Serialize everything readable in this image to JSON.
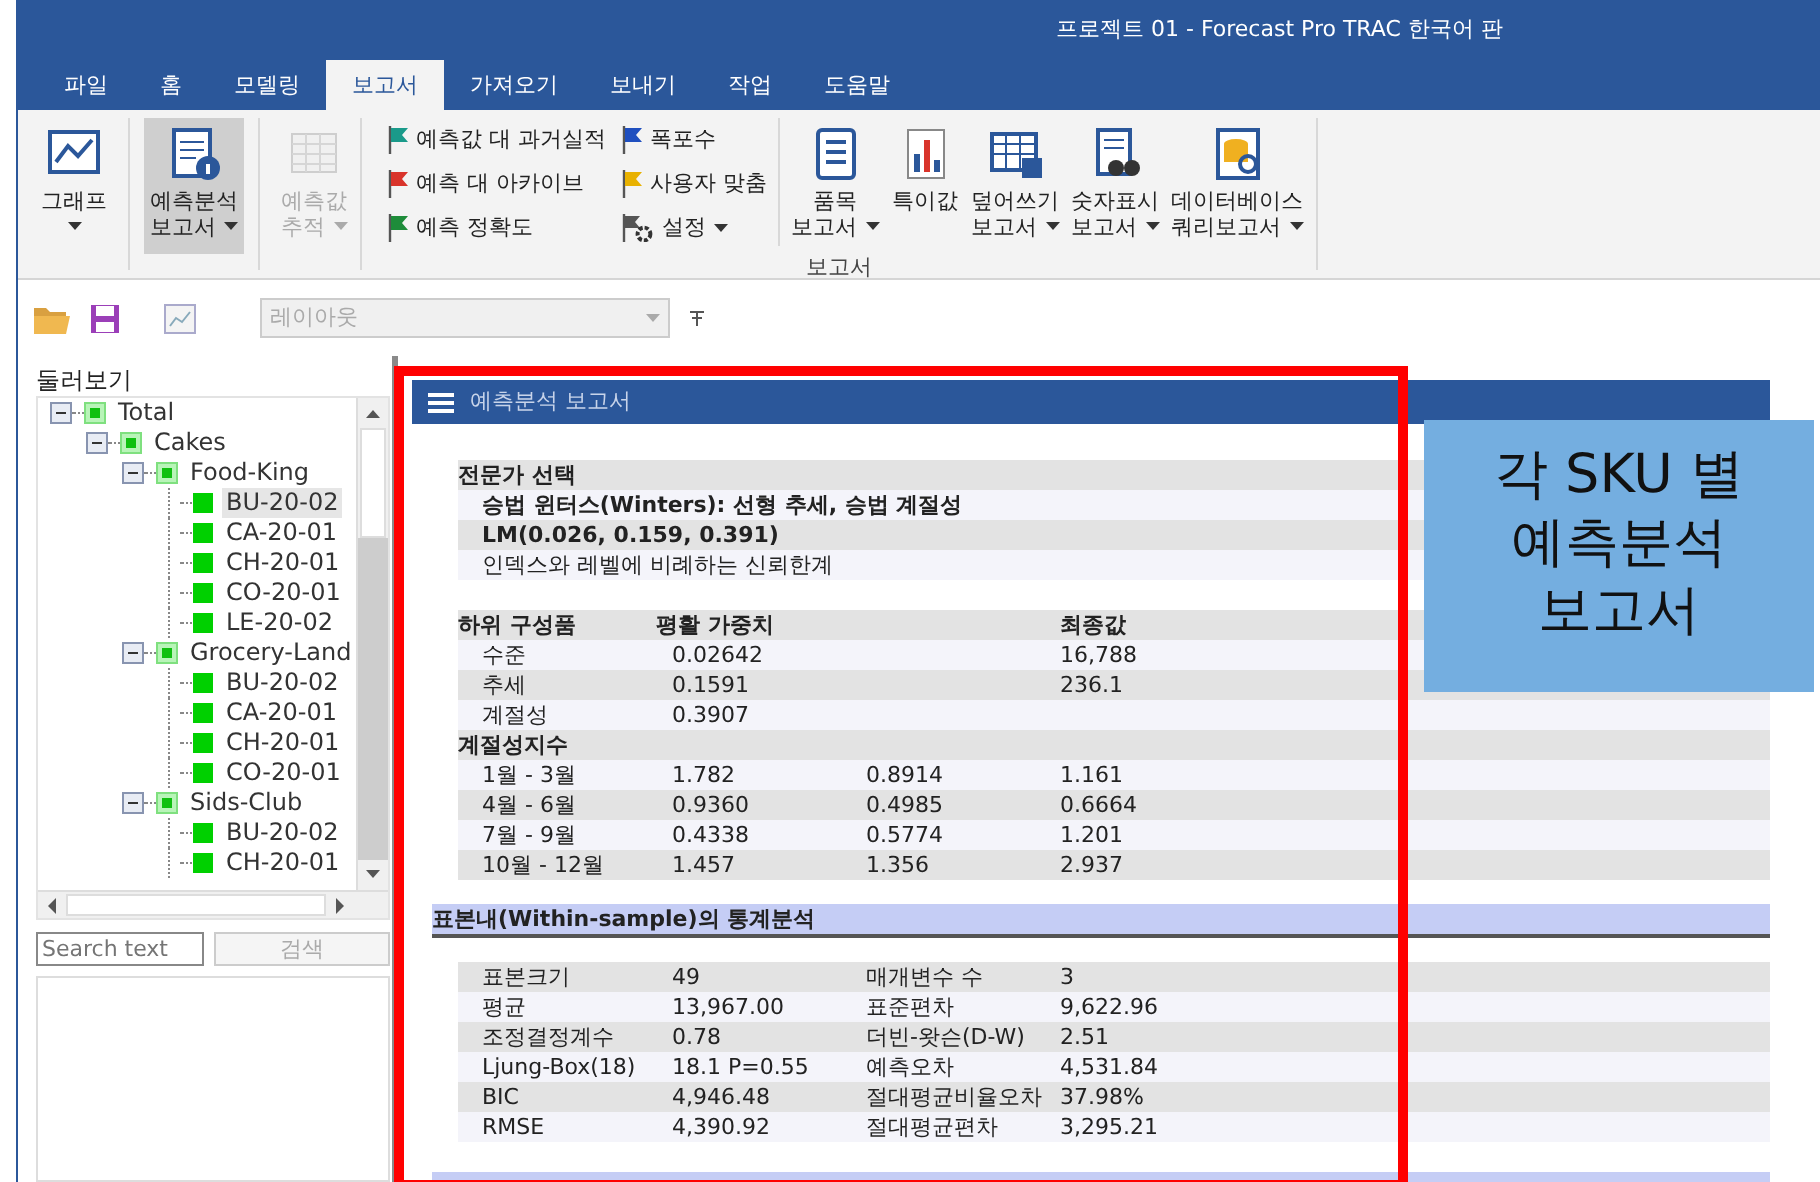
{
  "window": {
    "title": "프로젝트 01 - Forecast Pro TRAC 한국어 판"
  },
  "tabs": [
    {
      "label": "파일",
      "selected": false
    },
    {
      "label": "홈",
      "selected": false
    },
    {
      "label": "모델링",
      "selected": false
    },
    {
      "label": "보고서",
      "selected": true
    },
    {
      "label": "가져오기",
      "selected": false
    },
    {
      "label": "보내기",
      "selected": false
    },
    {
      "label": "작업",
      "selected": false
    },
    {
      "label": "도움말",
      "selected": false
    }
  ],
  "ribbon": {
    "left_buttons": [
      {
        "lines": [
          "그래프"
        ],
        "dropdown": true,
        "selected": false,
        "disabled": false
      },
      {
        "lines": [
          "예측분석",
          "보고서"
        ],
        "dropdown": true,
        "selected": true,
        "disabled": false
      },
      {
        "lines": [
          "예측값",
          "추적"
        ],
        "dropdown": true,
        "selected": false,
        "disabled": true
      }
    ],
    "small_buttons": [
      {
        "kind": "flag",
        "label": "예측값 대 과거실적",
        "color": "#1a9a8a",
        "dropdown": false
      },
      {
        "kind": "flag",
        "label": "예측 대 아카이브",
        "color": "#d9342b",
        "dropdown": false
      },
      {
        "kind": "flag",
        "label": "예측 정확도",
        "color": "#1e8c3a",
        "dropdown": false
      },
      {
        "kind": "flag",
        "label": "폭포수",
        "color": "#1f4fbf",
        "dropdown": false
      },
      {
        "kind": "flag",
        "label": "사용자 맞춤",
        "color": "#e8b100",
        "dropdown": false
      },
      {
        "kind": "settings",
        "label": "설정",
        "color": "#555555",
        "dropdown": true
      }
    ],
    "right_buttons": [
      {
        "lines": [
          "품목",
          "보고서"
        ],
        "dropdown": true
      },
      {
        "lines": [
          "특이값"
        ],
        "dropdown": false
      },
      {
        "lines": [
          "덮어쓰기",
          "보고서"
        ],
        "dropdown": true
      },
      {
        "lines": [
          "숫자표시",
          "보고서"
        ],
        "dropdown": true
      },
      {
        "lines": [
          "데이터베이스",
          "쿼리보고서"
        ],
        "dropdown": true
      }
    ],
    "group_label": "보고서"
  },
  "toolbar": {
    "layout_select": {
      "placeholder": "레이아웃",
      "disabled": true
    }
  },
  "navigator": {
    "title": "둘러보기",
    "tree": [
      {
        "label": "Total",
        "expanded": true,
        "selected": false,
        "children": [
          {
            "label": "Cakes",
            "expanded": true,
            "selected": false,
            "children": [
              {
                "label": "Food-King",
                "expanded": true,
                "selected": false,
                "children": [
                  {
                    "label": "BU-20-02",
                    "selected": true
                  },
                  {
                    "label": "CA-20-01",
                    "selected": false
                  },
                  {
                    "label": "CH-20-01",
                    "selected": false
                  },
                  {
                    "label": "CO-20-01",
                    "selected": false
                  },
                  {
                    "label": "LE-20-02",
                    "selected": false
                  }
                ]
              },
              {
                "label": "Grocery-Land",
                "expanded": true,
                "selected": false,
                "children": [
                  {
                    "label": "BU-20-02",
                    "selected": false
                  },
                  {
                    "label": "CA-20-01",
                    "selected": false
                  },
                  {
                    "label": "CH-20-01",
                    "selected": false
                  },
                  {
                    "label": "CO-20-01",
                    "selected": false
                  }
                ]
              },
              {
                "label": "Sids-Club",
                "expanded": true,
                "selected": false,
                "children": [
                  {
                    "label": "BU-20-02",
                    "selected": false
                  },
                  {
                    "label": "CH-20-01",
                    "selected": false
                  }
                ]
              }
            ]
          }
        ]
      }
    ],
    "search": {
      "placeholder": "Search text"
    },
    "search_button": {
      "label": "검색",
      "disabled": true
    }
  },
  "report": {
    "title": "예측분석 보고서",
    "blocks": [
      {
        "kind": "table",
        "rows": [
          {
            "kind": "head",
            "label": "전문가 선택"
          },
          {
            "kind": "bold",
            "label": "승법 윈터스(Winters): 선형 추세, 승법 계절성"
          },
          {
            "kind": "bold",
            "label": "LM(0.026, 0.159, 0.391)"
          },
          {
            "kind": "item",
            "label": "인덱스와 레벨에 비례하는 신뢰한계"
          }
        ]
      },
      {
        "kind": "table",
        "rows": [
          {
            "kind": "head",
            "label": "하위 구성품",
            "column_2": "평활 가중치",
            "column_4": "최종값"
          },
          {
            "kind": "item",
            "label": "수준",
            "column_2": "0.02642",
            "column_4": "16,788"
          },
          {
            "kind": "item",
            "label": "추세",
            "column_2": "0.1591",
            "column_4": "236.1"
          },
          {
            "kind": "item",
            "label": "계절성",
            "column_2": "0.3907"
          },
          {
            "kind": "head",
            "label": "계절성지수"
          },
          {
            "kind": "item",
            "label": "1월 - 3월",
            "column_2": "1.782",
            "column_3": "0.8914",
            "column_4": "1.161"
          },
          {
            "kind": "item",
            "label": "4월 - 6월",
            "column_2": "0.9360",
            "column_3": "0.4985",
            "column_4": "0.6664"
          },
          {
            "kind": "item",
            "label": "7월 - 9월",
            "column_2": "0.4338",
            "column_3": "0.5774",
            "column_4": "1.201"
          },
          {
            "kind": "item",
            "label": "10월 - 12월",
            "column_2": "1.457",
            "column_3": "1.356",
            "column_4": "2.937"
          }
        ]
      },
      {
        "kind": "band",
        "label": "표본내(Within-sample)의 통계분석"
      },
      {
        "kind": "table",
        "rows": [
          {
            "kind": "item",
            "label": "표본크기",
            "column_2": "49",
            "column_3": "매개변수 수",
            "column_4": "3"
          },
          {
            "kind": "item",
            "label": "평균",
            "column_2": "13,967.00",
            "column_3": "표준편차",
            "column_4": "9,622.96"
          },
          {
            "kind": "item",
            "label": "조정결정계수",
            "column_2": "0.78",
            "column_3": "더빈-왓슨(D-W)",
            "column_4": "2.51"
          },
          {
            "kind": "item",
            "label": "Ljung-Box(18)",
            "column_2": "18.1 P=0.55",
            "column_3": "예측오차",
            "column_4": "4,531.84"
          },
          {
            "kind": "item",
            "label": "BIC",
            "column_2": "4,946.48",
            "column_3": "절대평균비율오차",
            "column_4": "37.98%"
          },
          {
            "kind": "item",
            "label": "RMSE",
            "column_2": "4,390.92",
            "column_3": "절대평균편차",
            "column_4": "3,295.21"
          }
        ]
      }
    ]
  },
  "callout": {
    "lines": [
      "각 SKU 별",
      "예측분석",
      "보고서"
    ]
  }
}
